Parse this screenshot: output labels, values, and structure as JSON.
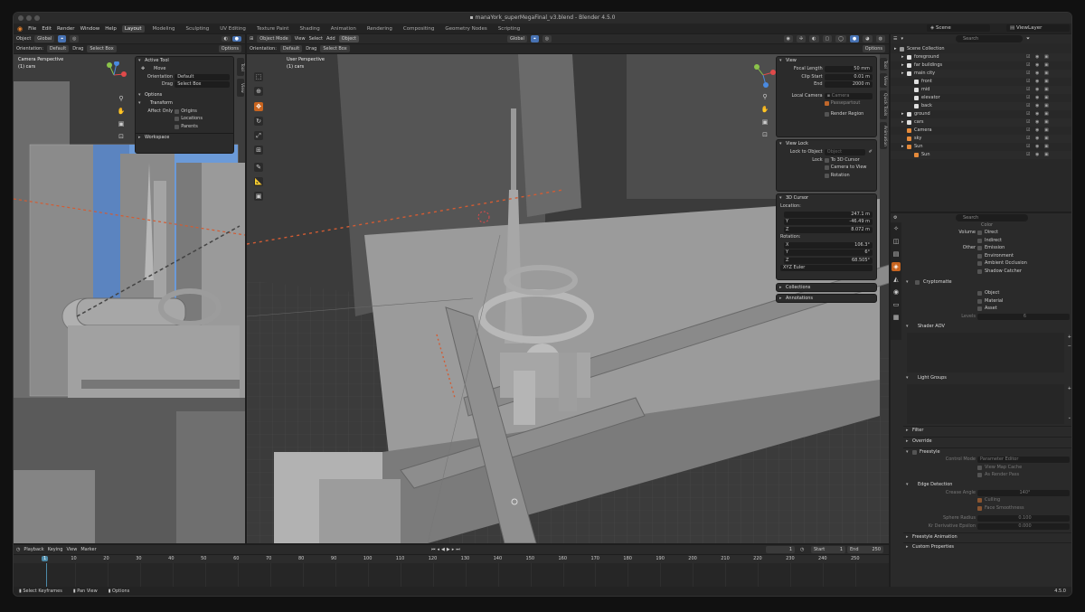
{
  "window": {
    "title": "manaYork_superMegaFinal_v3.blend - Blender 4.5.0"
  },
  "menu": {
    "items": [
      "File",
      "Edit",
      "Render",
      "Window",
      "Help"
    ],
    "workspaces": [
      "Layout",
      "Modeling",
      "Sculpting",
      "UV Editing",
      "Texture Paint",
      "Shading",
      "Animation",
      "Rendering",
      "Compositing",
      "Geometry Nodes",
      "Scripting"
    ],
    "active_workspace": "Layout",
    "scene_label": "Scene",
    "viewlayer_label": "ViewLayer"
  },
  "left_view": {
    "header": {
      "mode": "Object",
      "orientation_label": "Orientation:",
      "orientation_value": "Default",
      "drag_label": "Drag",
      "drag_value": "Select Box",
      "global": "Global",
      "options": "Options"
    },
    "title": "Camera Perspective",
    "subtitle": "(1) cars",
    "active_tool": {
      "header": "Active Tool",
      "tool_name": "Move",
      "orientation_label": "Orientation",
      "orientation_value": "Default",
      "drag_label": "Drag",
      "drag_value": "Select Box"
    },
    "options": {
      "header": "Options",
      "transform_header": "Transform",
      "affect_only_label": "Affect Only",
      "checks": [
        "Origins",
        "Locations",
        "Parents"
      ]
    },
    "workspace_header": "Workspace",
    "tabs": [
      "Tool",
      "View"
    ]
  },
  "main_view": {
    "header": {
      "mode": "Object Mode",
      "menus": [
        "View",
        "Select",
        "Add",
        "Object"
      ],
      "active_menu": "Object",
      "transform": "Global",
      "orientation_label": "Orientation:",
      "orientation_value": "Default",
      "drag_label": "Drag",
      "drag_value": "Select Box",
      "options": "Options"
    },
    "title": "User Perspective",
    "subtitle": "(1) cars",
    "tabs": [
      "Tool",
      "View",
      "Quick Tools",
      "Animation"
    ]
  },
  "npanel": {
    "view_header": "View",
    "focal_length_label": "Focal Length",
    "focal_length": "50 mm",
    "clip_start_label": "Clip Start",
    "clip_start": "0.01 m",
    "end_label": "End",
    "end": "2000 m",
    "local_camera_label": "Local Camera",
    "local_camera": "Camera",
    "passepartout_label": "Passepartout",
    "render_region_label": "Render Region",
    "view_lock_header": "View Lock",
    "lock_to_object_label": "Lock to Object",
    "lock_to_object": "Object",
    "lock_label": "Lock",
    "lock_checks": [
      "To 3D Cursor",
      "Camera to View",
      "Rotation"
    ],
    "cursor_header": "3D Cursor",
    "location_label": "Location:",
    "loc": [
      {
        "axis": "X",
        "value": "247.1 m"
      },
      {
        "axis": "Y",
        "value": "-46.49 m"
      },
      {
        "axis": "Z",
        "value": "8.072 m"
      }
    ],
    "rotation_label": "Rotation:",
    "rot": [
      {
        "axis": "X",
        "value": "106.3°"
      },
      {
        "axis": "Y",
        "value": "6°"
      },
      {
        "axis": "Z",
        "value": "68.505°"
      }
    ],
    "rotation_mode": "XYZ Euler",
    "collections_header": "Collections",
    "annotations_header": "Annotations"
  },
  "outliner": {
    "search_placeholder": "Search",
    "rows": [
      {
        "name": "Scene Collection",
        "indent": 0,
        "color": "#9a9a9a"
      },
      {
        "name": "foreground",
        "indent": 1,
        "color": "#e0e0e0"
      },
      {
        "name": "far buildings",
        "indent": 1,
        "color": "#e0e0e0"
      },
      {
        "name": "main city",
        "indent": 1,
        "color": "#e0e0e0"
      },
      {
        "name": "front",
        "indent": 2,
        "color": "#e0e0e0"
      },
      {
        "name": "mid",
        "indent": 2,
        "color": "#e0e0e0"
      },
      {
        "name": "elevator",
        "indent": 2,
        "color": "#e0e0e0"
      },
      {
        "name": "back",
        "indent": 2,
        "color": "#e0e0e0"
      },
      {
        "name": "ground",
        "indent": 1,
        "color": "#e0e0e0"
      },
      {
        "name": "cars",
        "indent": 1,
        "color": "#e0e0e0"
      },
      {
        "name": "Camera",
        "indent": 1,
        "color": "#e58a3a"
      },
      {
        "name": "sky",
        "indent": 1,
        "color": "#e58a3a"
      },
      {
        "name": "Sun",
        "indent": 1,
        "color": "#e58a3a"
      },
      {
        "name": "Sun",
        "indent": 2,
        "color": "#e58a3a"
      }
    ]
  },
  "properties": {
    "search_placeholder": "Search",
    "color_label": "Color",
    "volume_label": "Volume",
    "volume_checks": [
      "Direct",
      "Indirect"
    ],
    "other_label": "Other",
    "other_checks": [
      "Emission",
      "Environment",
      "Ambient Occlusion",
      "Shadow Catcher"
    ],
    "cryptomatte_header": "Cryptomatte",
    "crypto_checks": [
      "Object",
      "Material",
      "Asset"
    ],
    "levels_label": "Levels",
    "levels_value": "6",
    "shader_aov_header": "Shader AOV",
    "light_groups_header": "Light Groups",
    "filter_header": "Filter",
    "override_header": "Override",
    "freestyle_header": "Freestyle",
    "control_mode_label": "Control Mode",
    "control_mode": "Parameter Editor",
    "freestyle_checks": [
      "View Map Cache",
      "As Render Pass"
    ],
    "edge_detection_header": "Edge Detection",
    "crease_angle_label": "Crease Angle",
    "crease_angle": "140°",
    "edge_checks": [
      "Culling",
      "Face Smoothness"
    ],
    "sphere_radius_label": "Sphere Radius",
    "sphere_radius": "0.100",
    "kr_epsilon_label": "Kr Derivative Epsilon",
    "kr_epsilon": "0.000",
    "freestyle_animation_header": "Freestyle Animation",
    "custom_properties_header": "Custom Properties"
  },
  "timeline": {
    "menus": [
      "Playback",
      "Keying",
      "View",
      "Marker"
    ],
    "current_frame": "1",
    "start_label": "Start",
    "start": "1",
    "end_label": "End",
    "end": "250",
    "ticks": [
      "1",
      "10",
      "20",
      "30",
      "40",
      "50",
      "60",
      "70",
      "80",
      "90",
      "100",
      "110",
      "120",
      "130",
      "140",
      "150",
      "160",
      "170",
      "180",
      "190",
      "200",
      "210",
      "220",
      "230",
      "240",
      "250"
    ]
  },
  "statusbar": {
    "items": [
      "Select Keyframes",
      "Pan View",
      "Options"
    ],
    "version": "4.5.0"
  }
}
